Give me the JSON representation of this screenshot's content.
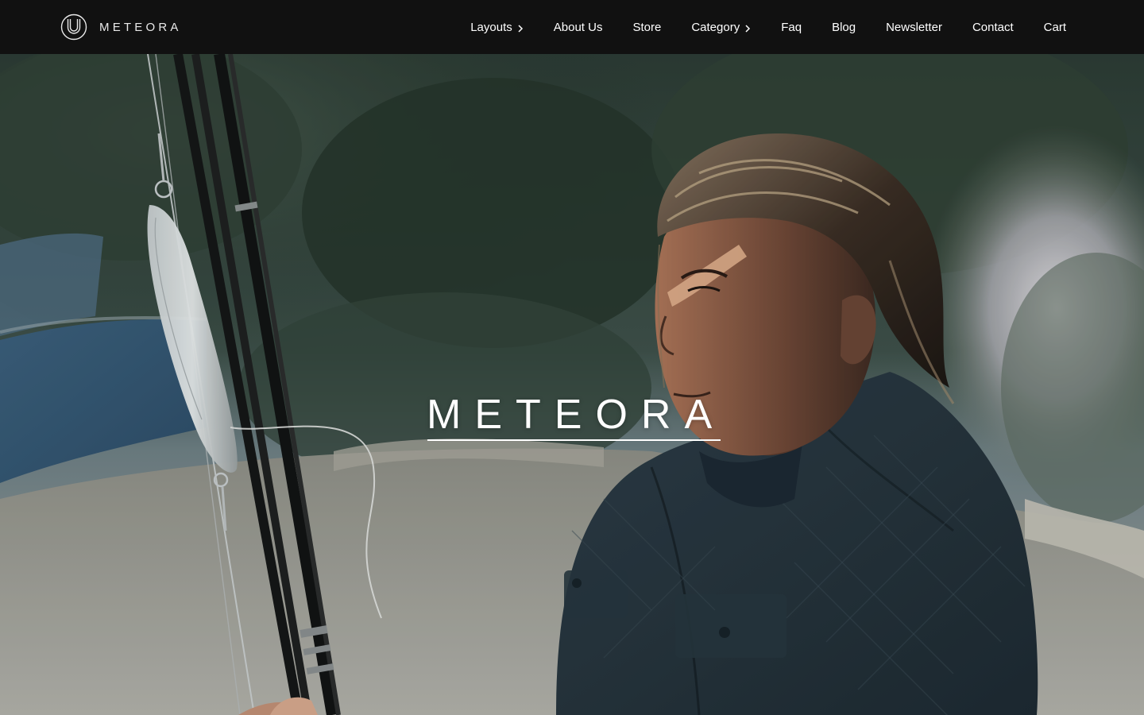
{
  "header": {
    "brand_name": "METEORA",
    "nav": [
      {
        "label": "Layouts",
        "has_submenu": true
      },
      {
        "label": "About Us",
        "has_submenu": false
      },
      {
        "label": "Store",
        "has_submenu": false
      },
      {
        "label": "Category",
        "has_submenu": true
      },
      {
        "label": "Faq",
        "has_submenu": false
      },
      {
        "label": "Blog",
        "has_submenu": false
      },
      {
        "label": "Newsletter",
        "has_submenu": false
      },
      {
        "label": "Contact",
        "has_submenu": false
      },
      {
        "label": "Cart",
        "has_submenu": false
      }
    ]
  },
  "hero": {
    "title": "METEORA",
    "image": "man-with-fishing-rods-photo"
  },
  "colors": {
    "header_bg": "#111111",
    "nav_text": "#ffffff",
    "hero_text": "#ffffff"
  },
  "icons": {
    "logo": "meteora-logo-icon",
    "submenu": "chevron-right-icon"
  }
}
